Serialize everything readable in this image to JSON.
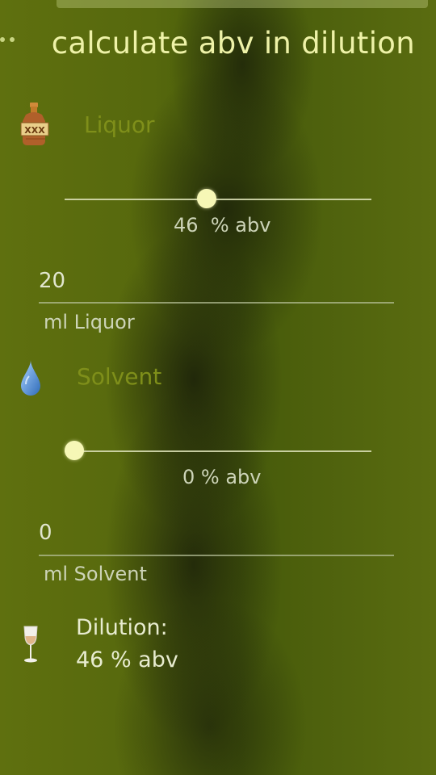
{
  "header": {
    "title": "calculate abv in dilution"
  },
  "liquor": {
    "section_label": "Liquor",
    "abv_value": "46",
    "abv_unit": "% abv",
    "abv_fraction": 0.46,
    "amount_value": "20",
    "amount_caption": "ml Liquor",
    "icon": "liquor-bottle-icon",
    "bottle_mark": "XXX"
  },
  "solvent": {
    "section_label": "Solvent",
    "abv_text": "0 % abv",
    "abv_fraction": 0,
    "amount_value": "0",
    "amount_caption": "ml Solvent",
    "icon": "water-drop-icon"
  },
  "dilution": {
    "title": "Dilution:",
    "value": "46 % abv",
    "icon": "wine-glass-icon"
  },
  "colors": {
    "accent": "#eef2a8",
    "section_label": "#7f8f1a",
    "knob": "#f6f7b6"
  }
}
